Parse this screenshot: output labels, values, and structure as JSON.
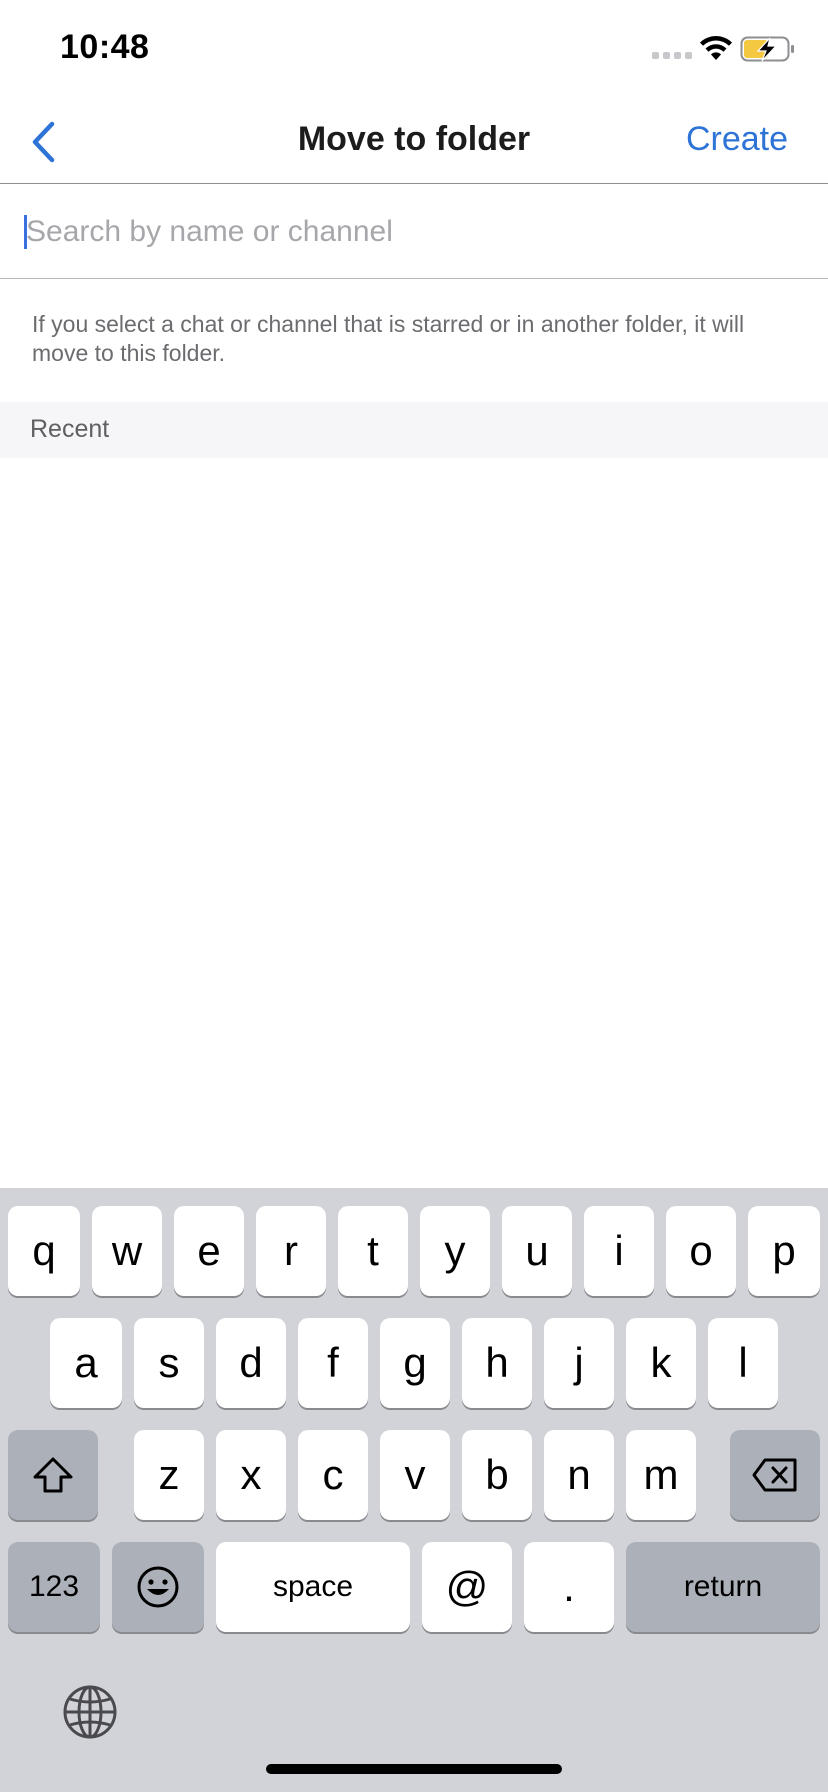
{
  "status_bar": {
    "time": "10:48"
  },
  "nav": {
    "title": "Move to folder",
    "create_label": "Create"
  },
  "search": {
    "placeholder": "Search by name or channel",
    "value": ""
  },
  "hint": "If you select a chat or channel that is starred or in another folder, it will move to this folder.",
  "section": {
    "recent_label": "Recent"
  },
  "keyboard": {
    "row1": [
      "q",
      "w",
      "e",
      "r",
      "t",
      "y",
      "u",
      "i",
      "o",
      "p"
    ],
    "row2": [
      "a",
      "s",
      "d",
      "f",
      "g",
      "h",
      "j",
      "k",
      "l"
    ],
    "row3": [
      "z",
      "x",
      "c",
      "v",
      "b",
      "n",
      "m"
    ],
    "numbers_label": "123",
    "space_label": "space",
    "at_label": "@",
    "period_label": ".",
    "return_label": "return"
  },
  "icons": {
    "back": "chevron-left-icon",
    "shift": "shift-icon",
    "backspace": "backspace-icon",
    "emoji": "emoji-icon",
    "globe": "globe-icon",
    "wifi": "wifi-icon",
    "battery": "battery-charging-icon"
  },
  "colors": {
    "accent": "#2d74d6",
    "battery_fill": "#f5c842"
  }
}
